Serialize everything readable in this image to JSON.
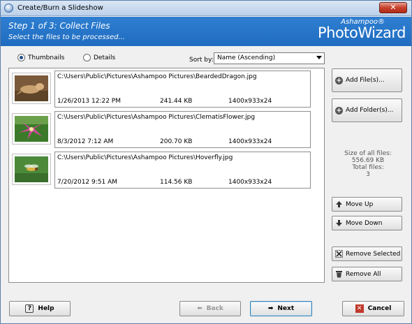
{
  "window": {
    "title": "Create/Burn a Slideshow",
    "close_label": "✕"
  },
  "header": {
    "step_title": "Step 1 of 3: Collect Files",
    "step_subtitle": "Select the files to be processed...",
    "brand_small": "Ashampoo®",
    "brand_big": "PhotoWizard",
    "color": "#1f6cc0"
  },
  "view": {
    "thumbnails_label": "Thumbnails",
    "details_label": "Details",
    "selected": "Thumbnails",
    "sort_by_label": "Sort by:",
    "sort_value": "Name (Ascending)"
  },
  "files": [
    {
      "path": "C:\\Users\\Public\\Pictures\\Ashampoo Pictures\\BeardedDragon.jpg",
      "date": "1/26/2013 12:22 PM",
      "size": "241.44 KB",
      "dims": "1400x933x24",
      "thumb": "bearded-dragon-thumbnail"
    },
    {
      "path": "C:\\Users\\Public\\Pictures\\Ashampoo Pictures\\ClematisFlower.jpg",
      "date": "8/3/2012 7:12 AM",
      "size": "200.70 KB",
      "dims": "1400x933x24",
      "thumb": "clematis-flower-thumbnail"
    },
    {
      "path": "C:\\Users\\Public\\Pictures\\Ashampoo Pictures\\Hoverfly.jpg",
      "date": "7/20/2012 9:51 AM",
      "size": "114.56 KB",
      "dims": "1400x933x24",
      "thumb": "hoverfly-thumbnail"
    }
  ],
  "actions": {
    "add_files": "Add File(s)...",
    "add_folder": "Add Folder(s)...",
    "move_up": "Move Up",
    "move_down": "Move Down",
    "remove_selected": "Remove Selected",
    "remove_all": "Remove All"
  },
  "stats": {
    "size_label": "Size of all files:",
    "size_value": "556.69 KB",
    "count_label": "Total files:",
    "count_value": "3"
  },
  "footer": {
    "help": "Help",
    "back": "Back",
    "next": "Next",
    "cancel": "Cancel"
  }
}
